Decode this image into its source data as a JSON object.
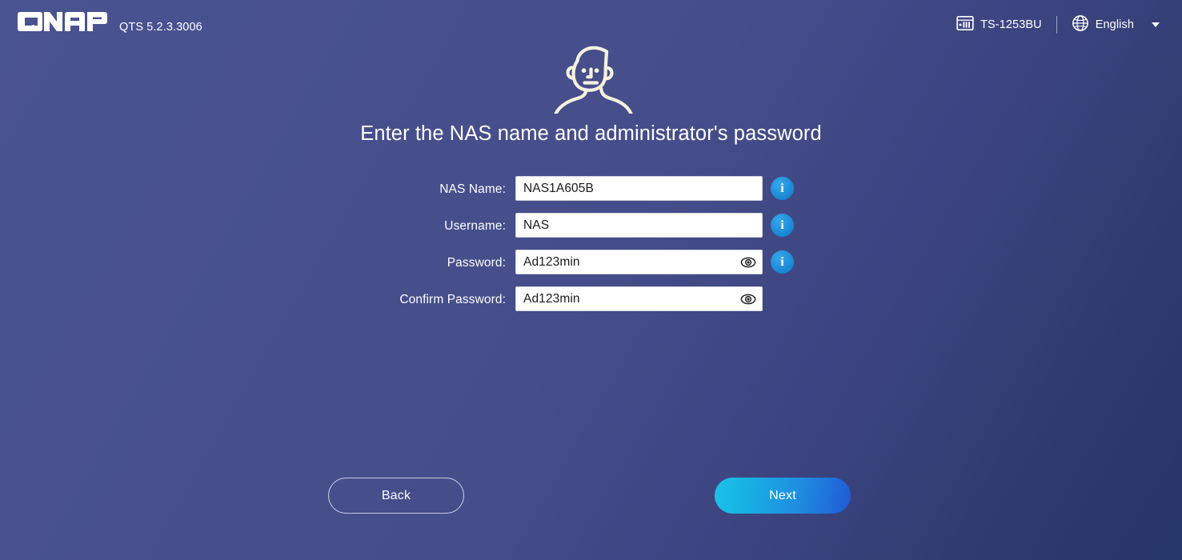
{
  "header": {
    "logo_text": "QNAP",
    "firmware_version": "QTS 5.2.3.3006",
    "model": "TS-1253BU",
    "language": "English",
    "model_icon": "nas-enclosure-icon",
    "language_icon": "globe-icon",
    "caret_icon": "chevron-down-icon"
  },
  "main": {
    "avatar_icon": "administrator-person-icon",
    "title": "Enter the NAS name and administrator's password",
    "fields": [
      {
        "label": "NAS Name:",
        "value": "NAS1A605B",
        "placeholder": "",
        "has_eye": false,
        "has_info": true,
        "name": "nas-name"
      },
      {
        "label": "Username:",
        "value": "NAS",
        "placeholder": "",
        "has_eye": false,
        "has_info": true,
        "name": "username"
      },
      {
        "label": "Password:",
        "value": "Ad123min",
        "placeholder": "",
        "has_eye": true,
        "has_info": true,
        "name": "password"
      },
      {
        "label": "Confirm Password:",
        "value": "Ad123min",
        "placeholder": "",
        "has_eye": true,
        "has_info": false,
        "name": "confirm-password"
      }
    ],
    "info_glyph": "i",
    "eye_icon": "eye-visibility-icon"
  },
  "footer": {
    "back_label": "Back",
    "next_label": "Next"
  },
  "colors": {
    "background_light": "#4a5392",
    "background_dark": "#26356a",
    "info_blue": "#1a86d4",
    "next_gradient_start": "#1dc2e8",
    "next_gradient_end": "#2159d6",
    "avatar_stroke": "#f5f1dc",
    "field_background": "#ffffff",
    "field_text": "#1b1b1b"
  }
}
